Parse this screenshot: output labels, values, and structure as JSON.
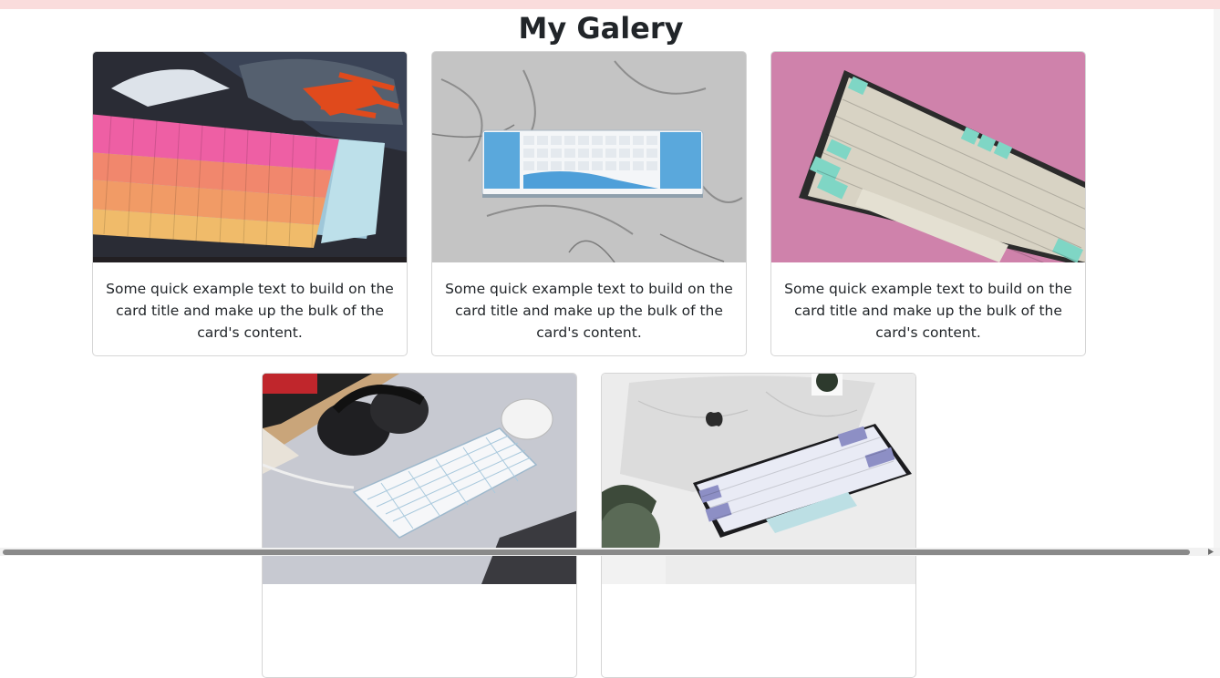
{
  "page": {
    "title": "My Galery"
  },
  "cards": [
    {
      "image": "pink-orange-keyboard-with-sneakers-photo",
      "text": "Some quick example text to build on the card title and make up the bulk of the card's content."
    },
    {
      "image": "blue-white-keyboard-on-marble-photo",
      "text": "Some quick example text to build on the card title and make up the bulk of the card's content."
    },
    {
      "image": "mint-beige-keyboard-on-pink-photo",
      "text": "Some quick example text to build on the card title and make up the bulk of the card's content."
    },
    {
      "image": "white-keyboard-with-headphones-and-mouse-photo",
      "text": ""
    },
    {
      "image": "lavender-keyboard-with-laptop-photo",
      "text": ""
    }
  ],
  "colors": {
    "top_bar": "#fadcdc",
    "card_border": "#d5d5d5",
    "text": "#212529"
  }
}
